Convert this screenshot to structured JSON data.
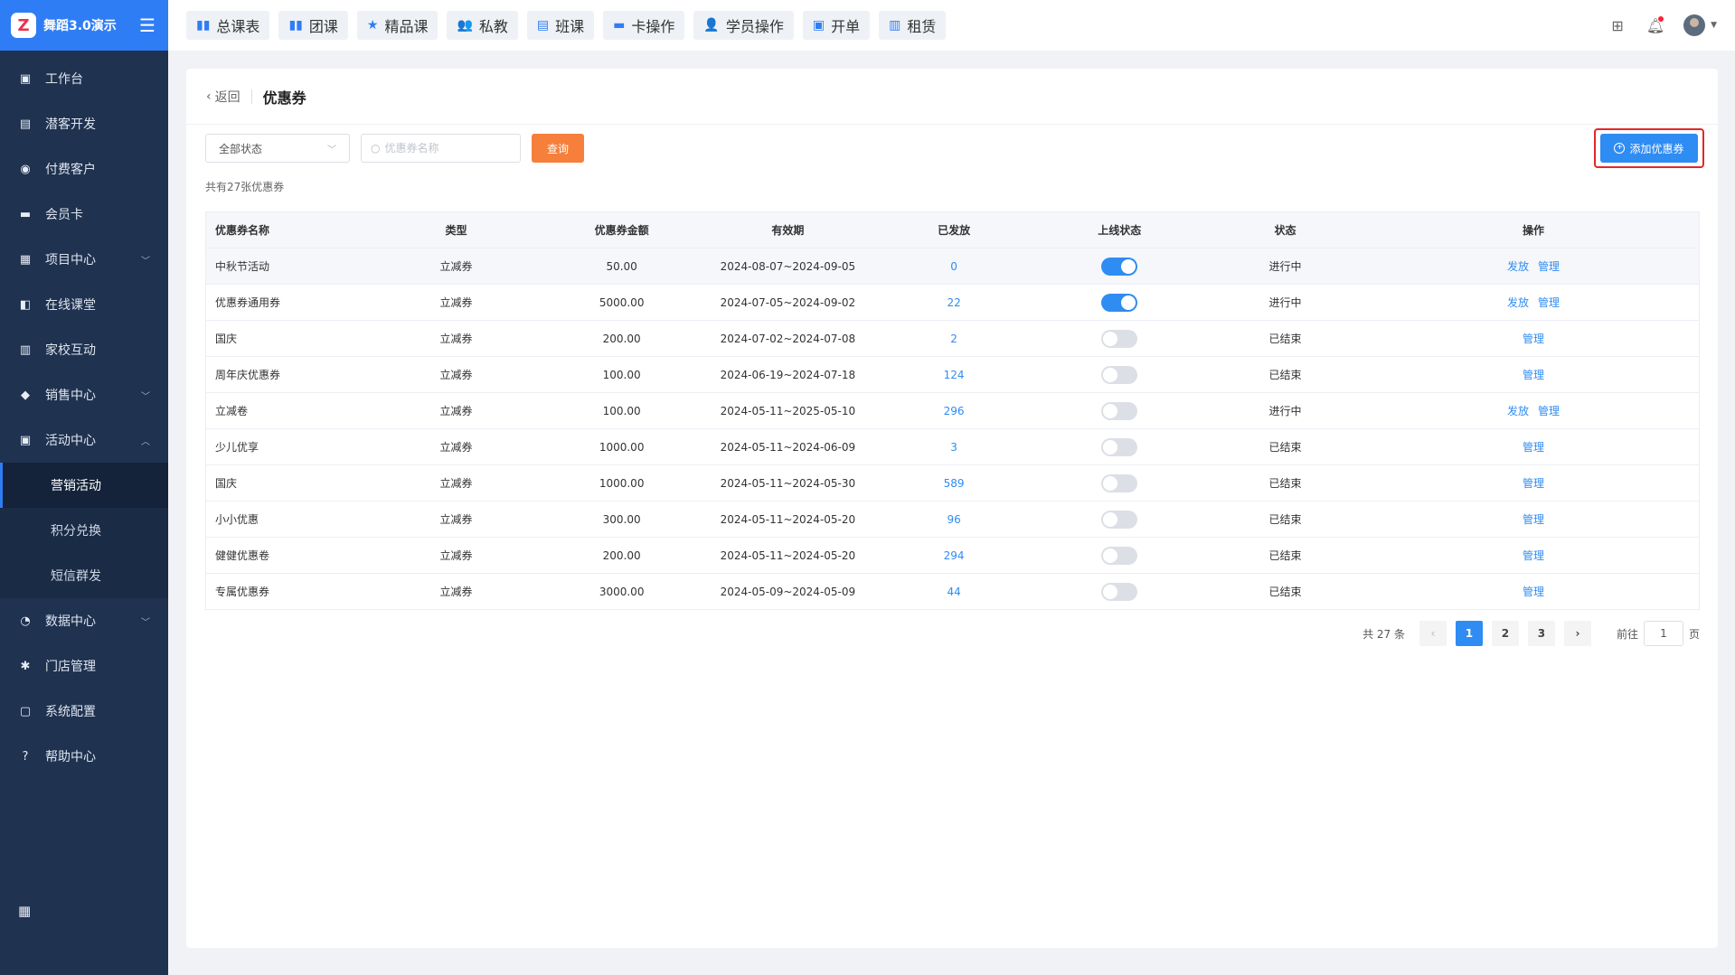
{
  "app": {
    "title": "舞蹈3.0演示",
    "logo_letter": "Z"
  },
  "sidebar": {
    "items": [
      {
        "label": "工作台",
        "icon": "▣"
      },
      {
        "label": "潜客开发",
        "icon": "▤"
      },
      {
        "label": "付费客户",
        "icon": "◉"
      },
      {
        "label": "会员卡",
        "icon": "▬"
      },
      {
        "label": "项目中心",
        "icon": "▦",
        "caret": "﹀"
      },
      {
        "label": "在线课堂",
        "icon": "◧"
      },
      {
        "label": "家校互动",
        "icon": "▥"
      },
      {
        "label": "销售中心",
        "icon": "◆",
        "caret": "﹀"
      },
      {
        "label": "活动中心",
        "icon": "▣",
        "caret": "︿"
      }
    ],
    "sub_items": [
      {
        "label": "营销活动"
      },
      {
        "label": "积分兑换"
      },
      {
        "label": "短信群发"
      }
    ],
    "items_after": [
      {
        "label": "数据中心",
        "icon": "◔",
        "caret": "﹀"
      },
      {
        "label": "门店管理",
        "icon": "✱"
      },
      {
        "label": "系统配置",
        "icon": "▢"
      },
      {
        "label": "帮助中心",
        "icon": "?"
      }
    ],
    "bottom_icon": "▦"
  },
  "topbar": {
    "tabs": [
      {
        "label": "总课表",
        "icon": "▮▮"
      },
      {
        "label": "团课",
        "icon": "▮▮"
      },
      {
        "label": "精品课",
        "icon": "★"
      },
      {
        "label": "私教",
        "icon": "👥"
      },
      {
        "label": "班课",
        "icon": "▤"
      },
      {
        "label": "卡操作",
        "icon": "▬"
      },
      {
        "label": "学员操作",
        "icon": "👤"
      },
      {
        "label": "开单",
        "icon": "▣"
      },
      {
        "label": "租赁",
        "icon": "▥"
      }
    ]
  },
  "page": {
    "back_label": "返回",
    "title": "优惠券",
    "status_select": "全部状态",
    "search_placeholder": "优惠券名称",
    "query_label": "查询",
    "add_label": "添加优惠券",
    "total_note": "共有27张优惠券"
  },
  "table": {
    "headers": [
      "优惠券名称",
      "类型",
      "优惠券金额",
      "有效期",
      "已发放",
      "上线状态",
      "状态",
      "操作"
    ],
    "rows": [
      {
        "name": "中秋节活动",
        "type": "立减券",
        "amount": "50.00",
        "period": "2024-08-07~2024-09-05",
        "issued": "0",
        "online": true,
        "status": "进行中",
        "ops": [
          "发放",
          "管理"
        ]
      },
      {
        "name": "优惠券通用券",
        "type": "立减券",
        "amount": "5000.00",
        "period": "2024-07-05~2024-09-02",
        "issued": "22",
        "online": true,
        "status": "进行中",
        "ops": [
          "发放",
          "管理"
        ]
      },
      {
        "name": "国庆",
        "type": "立减券",
        "amount": "200.00",
        "period": "2024-07-02~2024-07-08",
        "issued": "2",
        "online": false,
        "status": "已结束",
        "ops": [
          "管理"
        ]
      },
      {
        "name": "周年庆优惠券",
        "type": "立减券",
        "amount": "100.00",
        "period": "2024-06-19~2024-07-18",
        "issued": "124",
        "online": false,
        "status": "已结束",
        "ops": [
          "管理"
        ]
      },
      {
        "name": "立减卷",
        "type": "立减券",
        "amount": "100.00",
        "period": "2024-05-11~2025-05-10",
        "issued": "296",
        "online": false,
        "status": "进行中",
        "ops": [
          "发放",
          "管理"
        ]
      },
      {
        "name": "少儿优享",
        "type": "立减券",
        "amount": "1000.00",
        "period": "2024-05-11~2024-06-09",
        "issued": "3",
        "online": false,
        "status": "已结束",
        "ops": [
          "管理"
        ]
      },
      {
        "name": "国庆",
        "type": "立减券",
        "amount": "1000.00",
        "period": "2024-05-11~2024-05-30",
        "issued": "589",
        "online": false,
        "status": "已结束",
        "ops": [
          "管理"
        ]
      },
      {
        "name": "小小优惠",
        "type": "立减券",
        "amount": "300.00",
        "period": "2024-05-11~2024-05-20",
        "issued": "96",
        "online": false,
        "status": "已结束",
        "ops": [
          "管理"
        ]
      },
      {
        "name": "健健优惠卷",
        "type": "立减券",
        "amount": "200.00",
        "period": "2024-05-11~2024-05-20",
        "issued": "294",
        "online": false,
        "status": "已结束",
        "ops": [
          "管理"
        ]
      },
      {
        "name": "专属优惠券",
        "type": "立减券",
        "amount": "3000.00",
        "period": "2024-05-09~2024-05-09",
        "issued": "44",
        "online": false,
        "status": "已结束",
        "ops": [
          "管理"
        ]
      }
    ]
  },
  "pagination": {
    "total_label": "共 27 条",
    "pages": [
      "1",
      "2",
      "3"
    ],
    "current": "1",
    "goto_label": "前往",
    "goto_value": "1",
    "page_unit": "页"
  },
  "colors": {
    "primary": "#2f8cf3",
    "query": "#f57f3b",
    "sidebar": "#1f3250",
    "highlight": "#e4262a"
  }
}
